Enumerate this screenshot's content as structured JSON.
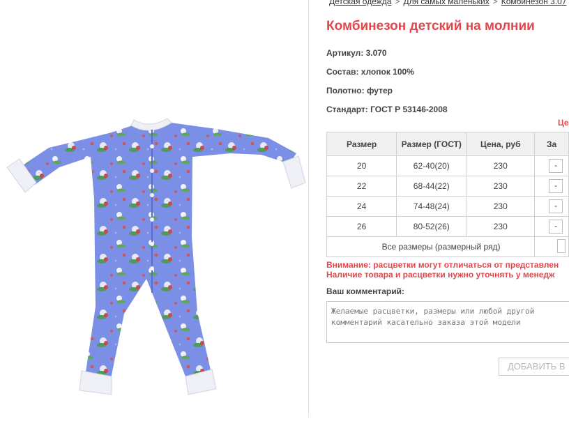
{
  "breadcrumb": {
    "items": [
      "Детская одежда",
      "Для самых маленьких",
      "Комбинезон 3.07"
    ],
    "separator": ">"
  },
  "product": {
    "title": "Комбинезон детский на молнии",
    "attributes": [
      {
        "label": "Артикул:",
        "value": "3.070"
      },
      {
        "label": "Состав:",
        "value": "хлопок 100%"
      },
      {
        "label": "Полотно:",
        "value": "футер"
      },
      {
        "label": "Стандарт:",
        "value": "ГОСТ Р 53146-2008"
      }
    ],
    "image": {
      "icon": "baby-sleepsuit-photo",
      "color": "#7b8fe6"
    }
  },
  "price_note": "Це",
  "table": {
    "headers": [
      "Размер",
      "Размер (ГОСТ)",
      "Цена, руб",
      "За"
    ],
    "rows": [
      {
        "size": "20",
        "gost": "62-40(20)",
        "price": "230",
        "qty": "-"
      },
      {
        "size": "22",
        "gost": "68-44(22)",
        "price": "230",
        "qty": "-"
      },
      {
        "size": "24",
        "gost": "74-48(24)",
        "price": "230",
        "qty": "-"
      },
      {
        "size": "26",
        "gost": "80-52(26)",
        "price": "230",
        "qty": "-"
      }
    ],
    "all_sizes_label": "Все размеры (размерный ряд)"
  },
  "warning": {
    "line1": "Внимание: расцветки могут отличаться от представлен",
    "line2": "Наличие товара и расцветки нужно уточнять у менедж"
  },
  "comment": {
    "label": "Ваш комментарий:",
    "placeholder": "Желаемые расцветки, размеры или любой другой комментарий касательно заказа этой модели"
  },
  "add_button": "ДОБАВИТЬ В",
  "colors": {
    "accent": "#e0474c",
    "garment": "#7b8fe6"
  }
}
